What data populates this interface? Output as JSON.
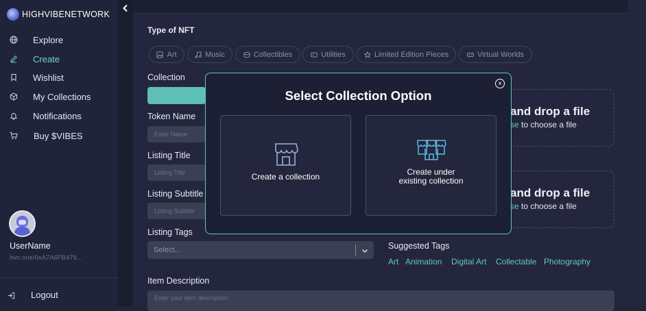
{
  "app": {
    "brand": "HIGHVIBENETWORK"
  },
  "sidebar": {
    "items": [
      {
        "label": "Explore",
        "icon": "globe-icon"
      },
      {
        "label": "Create",
        "icon": "pencil-icon",
        "active": true
      },
      {
        "label": "Wishlist",
        "icon": "bookmark-icon"
      },
      {
        "label": "My Collections",
        "icon": "cube-icon"
      },
      {
        "label": "Notifications",
        "icon": "bell-icon"
      },
      {
        "label": "Buy $VIBES",
        "icon": "cart-icon"
      }
    ],
    "user": {
      "name": "UserName",
      "address": "hvn.one/0xA7A6FB479..."
    },
    "logout_label": "Logout"
  },
  "form": {
    "type_label": "Type of NFT",
    "types": [
      {
        "label": "Art",
        "icon": "image-icon"
      },
      {
        "label": "Music",
        "icon": "music-icon"
      },
      {
        "label": "Collectibles",
        "icon": "coins-icon"
      },
      {
        "label": "Utilities",
        "icon": "ticket-icon"
      },
      {
        "label": "Limited Edition Pieces",
        "icon": "star-icon"
      },
      {
        "label": "Virtual Worlds",
        "icon": "vr-headset-icon"
      }
    ],
    "collection_label": "Collection",
    "token_name_label": "Token Name",
    "token_name_placeholder": "Enter Name",
    "listing_title_label": "Listing Title",
    "listing_title_placeholder": "Listing Title",
    "listing_subtitle_label": "Listing Subtitle",
    "listing_subtitle_placeholder": "Listing Subtitle",
    "listing_tags_label": "Listing Tags",
    "listing_tags_placeholder": "Select...",
    "item_description_label": "Item Description",
    "item_description_placeholder": "Enter your item description"
  },
  "dropzones": [
    {
      "title": "and drop a file",
      "link_fragment": "se",
      "suffix": " to choose a file"
    },
    {
      "title": "and drop a file",
      "link_fragment": "se",
      "suffix": " to choose a file"
    }
  ],
  "suggested": {
    "label": "Suggested Tags",
    "tags": [
      "Art",
      "Animation",
      "Digital Art",
      "Collectable",
      "Photography"
    ]
  },
  "modal": {
    "title": "Select Collection Option",
    "close_glyph": "×",
    "options": [
      {
        "label": "Create a collection",
        "icon": "storefront-icon"
      },
      {
        "label_line1": "Create under",
        "label_line2": "existing collection",
        "icon": "stores-row-icon"
      }
    ]
  },
  "colors": {
    "accent": "#5fc9c0",
    "background": "#23263c",
    "sidebar": "#20243a"
  }
}
